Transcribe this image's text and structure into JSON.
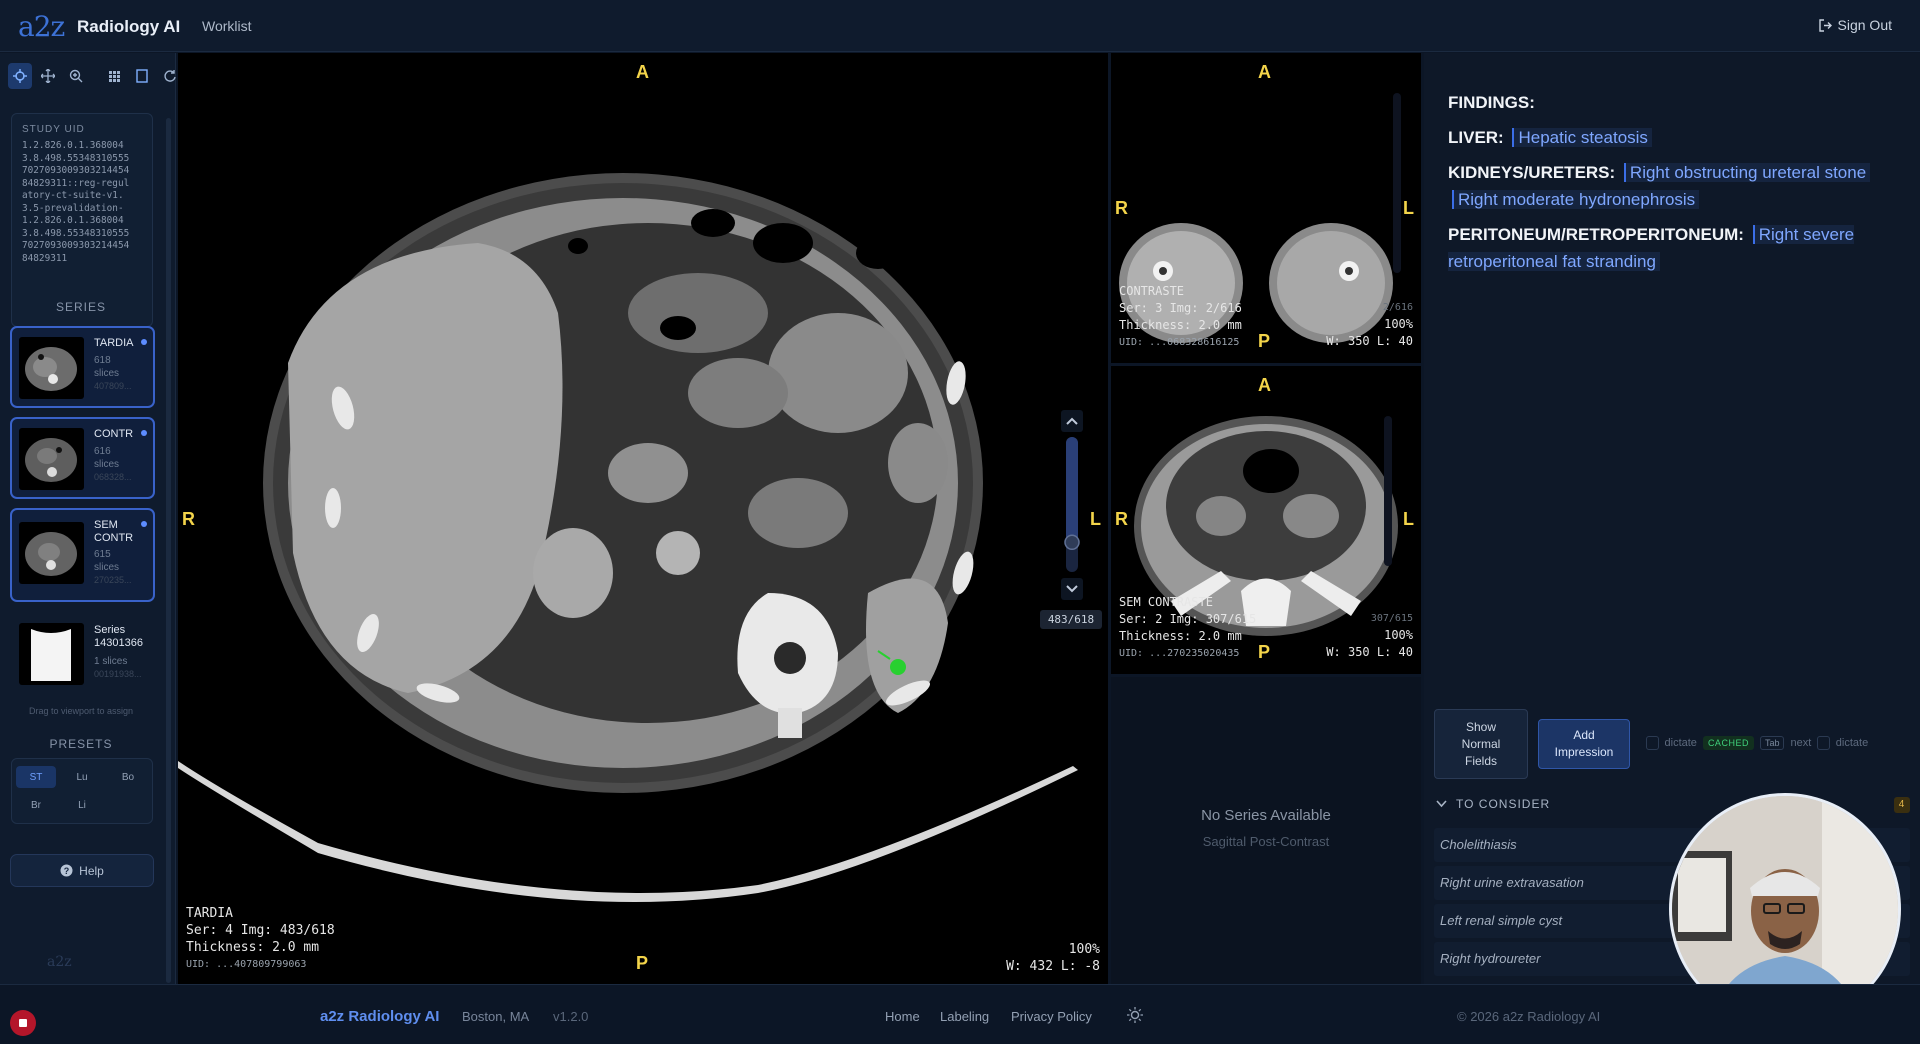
{
  "header": {
    "logo": "a2z",
    "app_name": "Radiology AI",
    "nav_worklist": "Worklist",
    "sign_out": "Sign Out"
  },
  "toolbar": {
    "tools": [
      "crosshair-icon",
      "pan-icon",
      "zoom-icon",
      "grid-layout-icon",
      "single-layout-icon",
      "reset-icon"
    ]
  },
  "study": {
    "uid_label": "STUDY UID",
    "uid_value": "1.2.826.0.1.368004\n3.8.498.55348310555\n7027093009303214454\n84829311::reg-regul\natory-ct-suite-v1.\n3.5-prevalidation-\n1.2.826.0.1.368004\n3.8.498.55348310555\n7027093009303214454\n84829311"
  },
  "series_panel": {
    "heading": "SERIES",
    "items": [
      {
        "name": "TARDIA",
        "slices": "618",
        "slices_unit": "slices",
        "id": "407809..."
      },
      {
        "name": "CONTR",
        "slices": "616",
        "slices_unit": "slices",
        "id": "068328..."
      },
      {
        "name": "SEM CONTR",
        "slices": "615",
        "slices_unit": "slices",
        "id": "270235..."
      },
      {
        "name": "Series 14301366",
        "slices": "1 slices",
        "slices_unit": "",
        "id": "00191938..."
      }
    ],
    "drag_hint": "Drag to viewport to assign"
  },
  "presets": {
    "heading": "PRESETS",
    "items": [
      "ST",
      "Lu",
      "Bo",
      "Br",
      "Li"
    ]
  },
  "help_label": "Help",
  "viewports": {
    "main": {
      "orient_top": "A",
      "orient_left": "R",
      "orient_right": "L",
      "orient_bottom": "P",
      "series_name": "TARDIA",
      "ser_img": "Ser: 4 Img: 483/618",
      "thickness": "Thickness: 2.0 mm",
      "uid": "UID: ...407809799063",
      "zoom": "100%",
      "wl": "W: 432 L: -8",
      "slice_readout": "483/618",
      "slice_position": 0.78
    },
    "top_right": {
      "orient_top": "A",
      "orient_left": "R",
      "orient_right": "L",
      "orient_bottom": "P",
      "series_name": "CONTRASTE",
      "ser_img": "Ser: 3 Img: 2/616",
      "thickness": "Thickness: 2.0 mm",
      "uid": "UID: ...068328616125",
      "zoom": "100%",
      "wl": "W: 350 L: 40",
      "slice_label": "2/616"
    },
    "mid_right": {
      "orient_top": "A",
      "orient_left": "R",
      "orient_right": "L",
      "orient_bottom": "P",
      "series_name": "SEM CONTRASTE",
      "ser_img": "Ser: 2 Img: 307/615",
      "thickness": "Thickness: 2.0 mm",
      "uid": "UID: ...270235020435",
      "zoom": "100%",
      "wl": "W: 350 L: 40",
      "slice_label": "307/615"
    },
    "bottom_right": {
      "title": "No Series Available",
      "subtitle": "Sagittal Post-Contrast"
    }
  },
  "report": {
    "findings_title": "FINDINGS:",
    "sections": [
      {
        "label": "LIVER:",
        "findings": [
          "Hepatic steatosis"
        ]
      },
      {
        "label": "KIDNEYS/URETERS:",
        "findings": [
          "Right obstructing ureteral stone",
          "Right moderate hydronephrosis"
        ]
      },
      {
        "label": "PERITONEUM/RETROPERITONEUM:",
        "findings": [
          "Right severe retroperitoneal fat stranding"
        ]
      }
    ],
    "show_normal_label": "Show Normal Fields",
    "add_impression_label": "Add Impression",
    "shortcut_dictate": "dictate",
    "shortcut_cached": "CACHED",
    "shortcut_tab": "Tab",
    "shortcut_next": "next",
    "shortcut_dictate2": "dictate",
    "to_consider_label": "TO CONSIDER",
    "to_consider_count": "4",
    "to_consider": [
      "Cholelithiasis",
      "Right urine extravasation",
      "Left renal simple cyst",
      "Right hydroureter"
    ]
  },
  "footer": {
    "brand": "a2z Radiology AI",
    "location": "Boston, MA",
    "version": "v1.2.0",
    "links": [
      "Home",
      "Labeling",
      "Privacy Policy"
    ],
    "copyright": "© 2026 a2z Radiology AI"
  },
  "colors": {
    "accent": "#3d72d6",
    "orientation_marker": "#f3d44a",
    "finding_text": "#7fa7ff",
    "record_button": "#b4162a"
  }
}
